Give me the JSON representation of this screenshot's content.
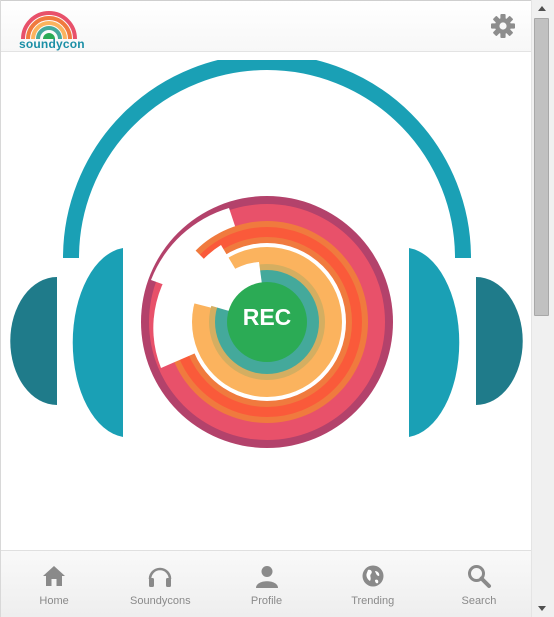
{
  "header": {
    "logo_text": "soundycon",
    "settings_icon": "gear-icon"
  },
  "hero": {
    "rec_label": "REC",
    "colors": {
      "teal": "#1aa0b5",
      "teal_dark": "#1f7b8a",
      "crimson": "#b3426b",
      "pink": "#e8516a",
      "orange": "#f07a3e",
      "light_orange": "#fbb35e",
      "sea_green": "#44a99b",
      "green": "#2bab55"
    }
  },
  "nav": {
    "items": [
      {
        "label": "Home",
        "icon": "home-icon"
      },
      {
        "label": "Soundycons",
        "icon": "headphones-icon"
      },
      {
        "label": "Profile",
        "icon": "user-icon"
      },
      {
        "label": "Trending",
        "icon": "globe-icon"
      },
      {
        "label": "Search",
        "icon": "search-icon"
      }
    ],
    "color": "#8a8a8a"
  }
}
